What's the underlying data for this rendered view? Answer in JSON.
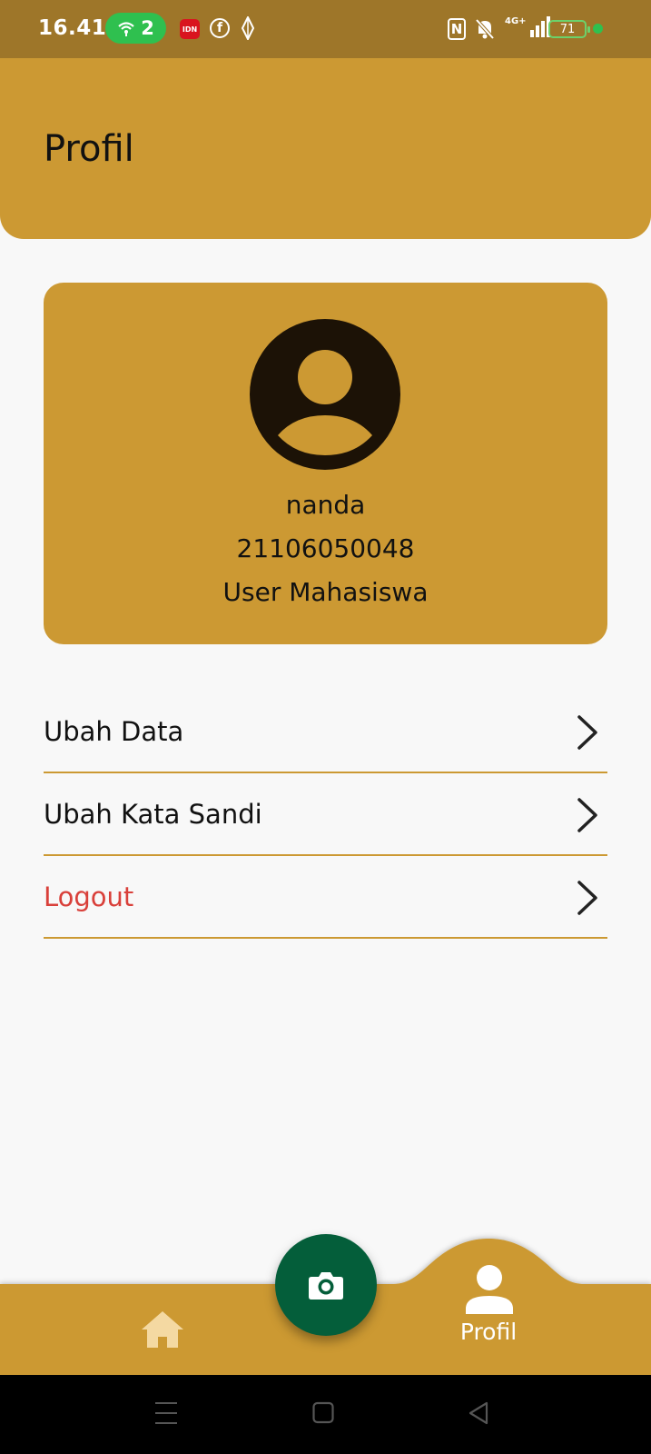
{
  "status_bar": {
    "time": "16.41",
    "hotspot_count": "2",
    "idn_label": "IDN",
    "facebook_glyph": "f",
    "nfc_glyph": "N",
    "network_type": "4G+",
    "battery": "71"
  },
  "header": {
    "title": "Profil"
  },
  "profile": {
    "name": "nanda",
    "nim": "21106050048",
    "role": "User Mahasiswa"
  },
  "menu": {
    "items": [
      {
        "label": "Ubah Data"
      },
      {
        "label": "Ubah Kata Sandi"
      },
      {
        "label": "Logout"
      }
    ]
  },
  "bottom_nav": {
    "profile_label": "Profil"
  },
  "icons": {
    "status": [
      "hotspot-icon",
      "idn-app-icon",
      "facebook-icon",
      "diamond-icon",
      "nfc-icon",
      "mute-icon",
      "signal-icon",
      "battery-icon"
    ],
    "menu": "chevron-right-icon",
    "nav": [
      "home-icon",
      "camera-icon",
      "person-icon"
    ],
    "system": [
      "menu-lines-icon",
      "square-home-icon",
      "triangle-back-icon"
    ]
  },
  "colors": {
    "status_bar": "#9e7629",
    "primary": "#cc9933",
    "fab": "#045e3a",
    "avatar": "#1c1206",
    "logout_text": "#d9403a",
    "background": "#f8f8f8",
    "hotspot_pill": "#2fc04f"
  }
}
